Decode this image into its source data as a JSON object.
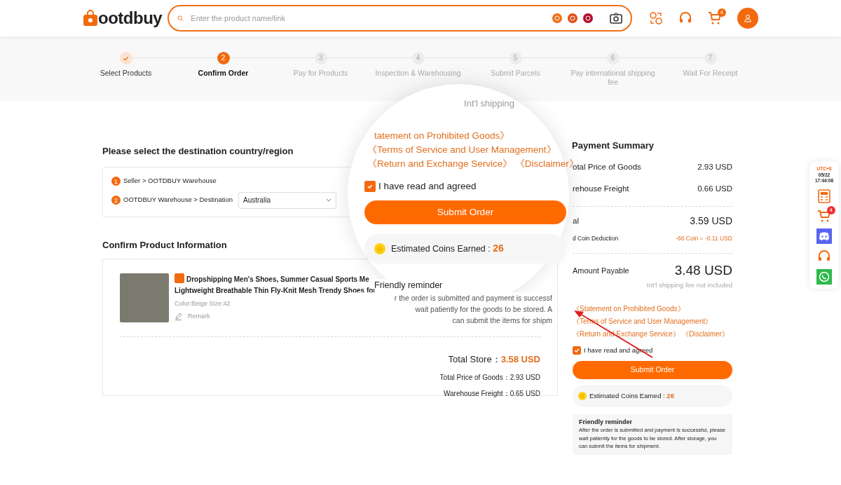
{
  "header": {
    "logo": "ootdbuy",
    "search": {
      "placeholder": "Enter the product name/link"
    },
    "cart_badge": "4"
  },
  "steps": [
    {
      "label": "Select Products",
      "completed": true,
      "selected": false
    },
    {
      "number": "2",
      "label": "Confirm Order",
      "completed": false,
      "selected": true
    },
    {
      "number": "3",
      "label": "Pay for Products",
      "completed": false,
      "selected": false
    },
    {
      "number": "4",
      "label": "Inspection & Warehousing",
      "completed": false,
      "selected": false
    },
    {
      "number": "5",
      "label": "Submit Parcels",
      "completed": false,
      "selected": false
    },
    {
      "number": "6",
      "label": "Pay international shipping fee",
      "completed": false,
      "selected": false
    },
    {
      "number": "7",
      "label": "Wait For Receipt",
      "completed": false,
      "selected": false
    }
  ],
  "destination": {
    "title": "Please select the destination country/region",
    "routes": [
      {
        "number": "1",
        "text": "Seller > OOTDBUY Warehouse"
      },
      {
        "number": "2",
        "text": "OOTDBUY Warehouse > Destination",
        "select": "Australia"
      }
    ]
  },
  "product": {
    "title": "Confirm Product Information",
    "name_lines": [
      "Dropshipping Men's Shoes, Summer Casual Sports Me",
      "Lightweight Breathable Thin Fly-Knit Mesh Trendy Shoes for"
    ],
    "spec": "Color:Beige Size:42",
    "remark": "Remark",
    "total_label": "Total Store：",
    "total_value": "3.58 USD",
    "rows": [
      {
        "label": "Total Price of Goods：",
        "value": "2.93 USD"
      },
      {
        "label": "Warehouse Freight：",
        "value": "0.65 USD"
      }
    ]
  },
  "summary": {
    "title": "Payment Summary",
    "rows": [
      {
        "label": "otal Price of Goods",
        "value": "2.93 USD"
      },
      {
        "label": "rehouse Freight",
        "value": "0.66 USD"
      }
    ],
    "total": {
      "label": "al",
      "value": "3.59 USD"
    },
    "deduction": {
      "label": "d Coin Deduction",
      "value": "-66 Coin = -0.11 USD"
    },
    "payable": {
      "label": "Amount Payable",
      "value": "3.48 USD",
      "note": "Int'l shipping fee not included"
    },
    "links": [
      "《Statement on Prohibited Goods》",
      "《Terms of Service and User Management》",
      "《Return and Exchange Service》",
      "《Disclaimer》"
    ],
    "agree": {
      "label": "I have read and agreed",
      "checked": true
    },
    "submit": "Submit Order",
    "coins": {
      "label": "Estimated Coins Earned : ",
      "value": "26"
    },
    "reminder": {
      "title": "Friendly reminder",
      "text": "After the order is submitted and payment is successful, please wait patiently for the goods to be stored. After storage, you can submit the items for shipment."
    }
  },
  "magnifier": {
    "shipping_note": "Int'l shipping",
    "links": [
      "tatement on Prohibited Goods》",
      "《Terms of Service and User Management》",
      "《Return and Exchange Service》",
      "《Disclaimer》"
    ],
    "agree": {
      "label": "I have read and agreed",
      "checked": true
    },
    "submit": "Submit Order",
    "coins": {
      "label": "Estimated Coins Earned : ",
      "value": "26"
    },
    "reminder_title": "Friendly reminder",
    "reminder_lines": [
      "r the order is submitted and payment is successf",
      "wait patiently for the goods to be stored. A",
      "can submit the items for shipm"
    ]
  },
  "side_toolbar": {
    "timezone": "UTC+8",
    "date": "05/22",
    "time": "17:44:08",
    "cart_badge": "4"
  }
}
